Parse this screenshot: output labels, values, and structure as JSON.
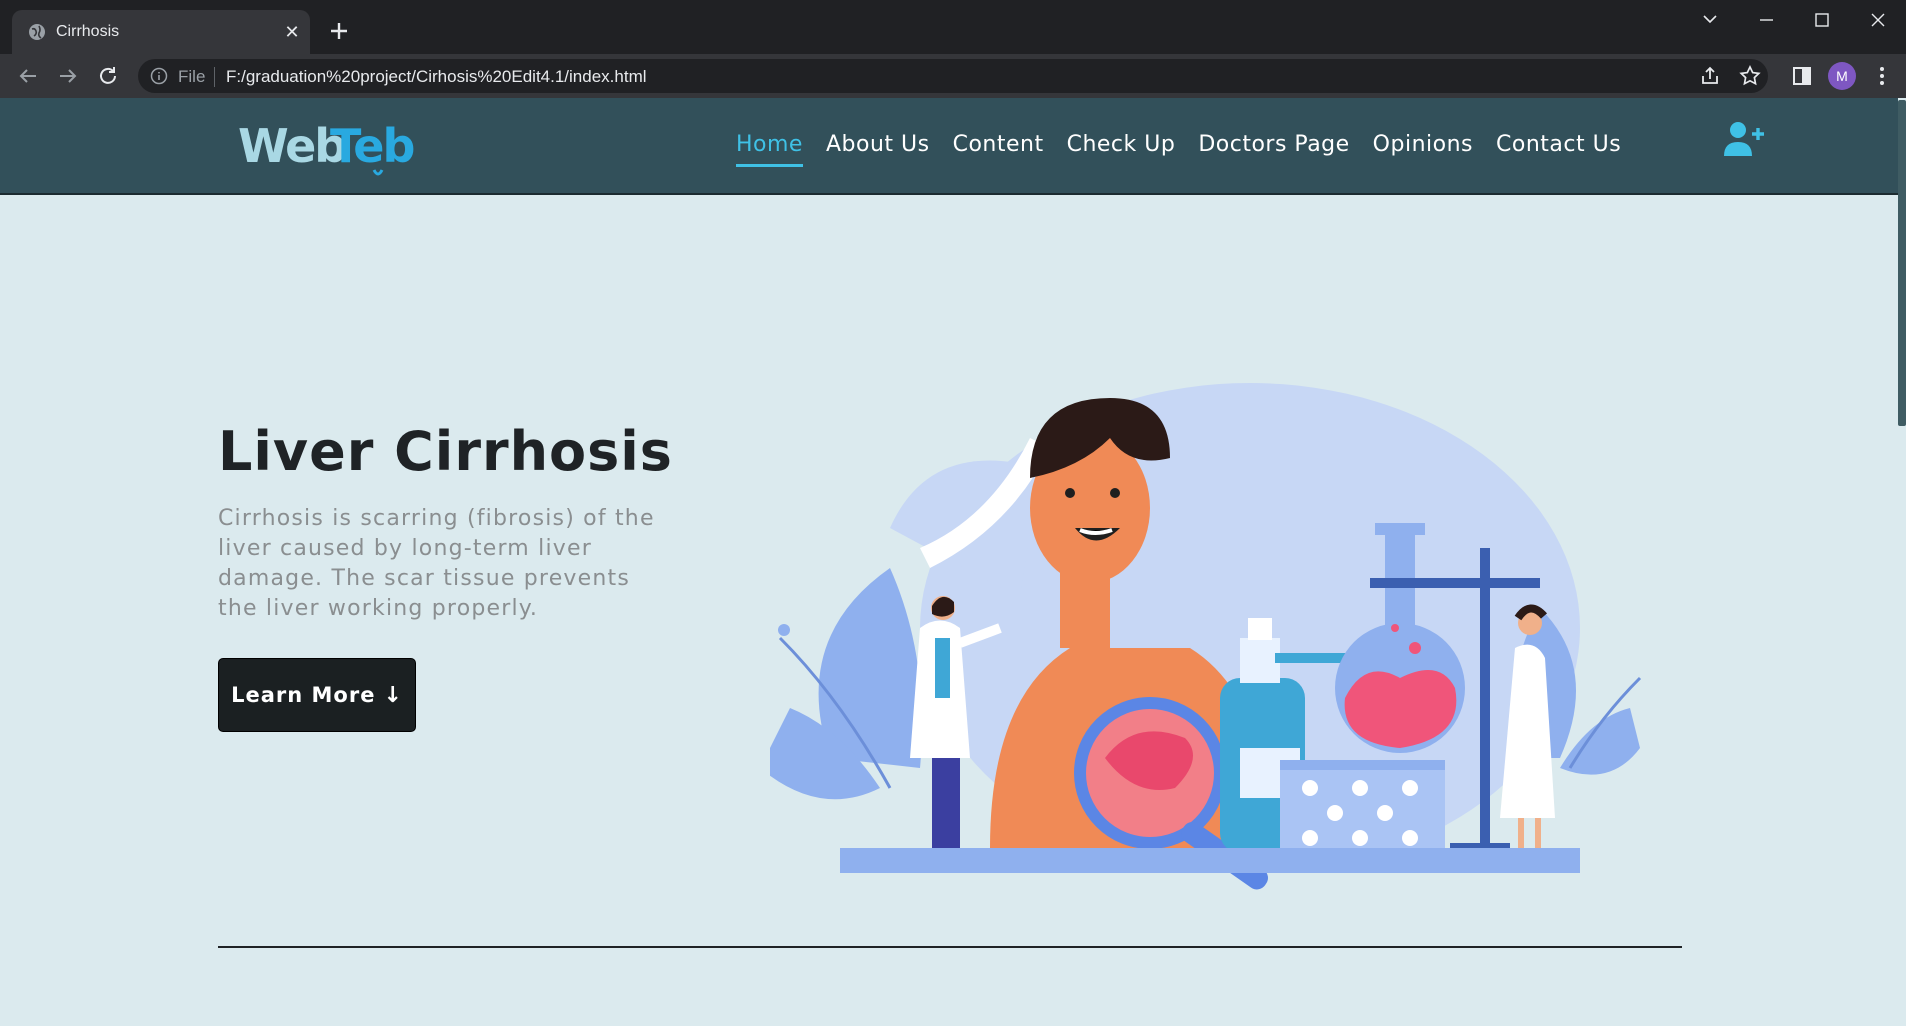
{
  "browser": {
    "tab_title": "Cirrhosis",
    "close_tab_glyph": "✕",
    "omnibox_scheme_label": "File",
    "url": "F:/graduation%20project/Cirhosis%20Edit4.1/index.html",
    "profile_initial": "M"
  },
  "site": {
    "logo_text_part1": "Web",
    "logo_text_part2": "Teb",
    "nav": [
      {
        "label": "Home",
        "active": true
      },
      {
        "label": "About Us"
      },
      {
        "label": "Content"
      },
      {
        "label": "Check Up"
      },
      {
        "label": "Doctors Page"
      },
      {
        "label": "Opinions"
      },
      {
        "label": "Contact Us"
      }
    ],
    "colors": {
      "header": "#32505a",
      "accent": "#3fc1e6",
      "page_bg": "#dbeaee",
      "button": "#1b2022"
    }
  },
  "hero": {
    "title": "Liver Cirrhosis",
    "text": "Cirrhosis is scarring (fibrosis) of the liver caused by long-term liver damage. The scar tissue prevents the liver working properly.",
    "button_label": "Learn More",
    "button_icon": "arrow-down-icon",
    "button_arrow_glyph": "↓"
  }
}
